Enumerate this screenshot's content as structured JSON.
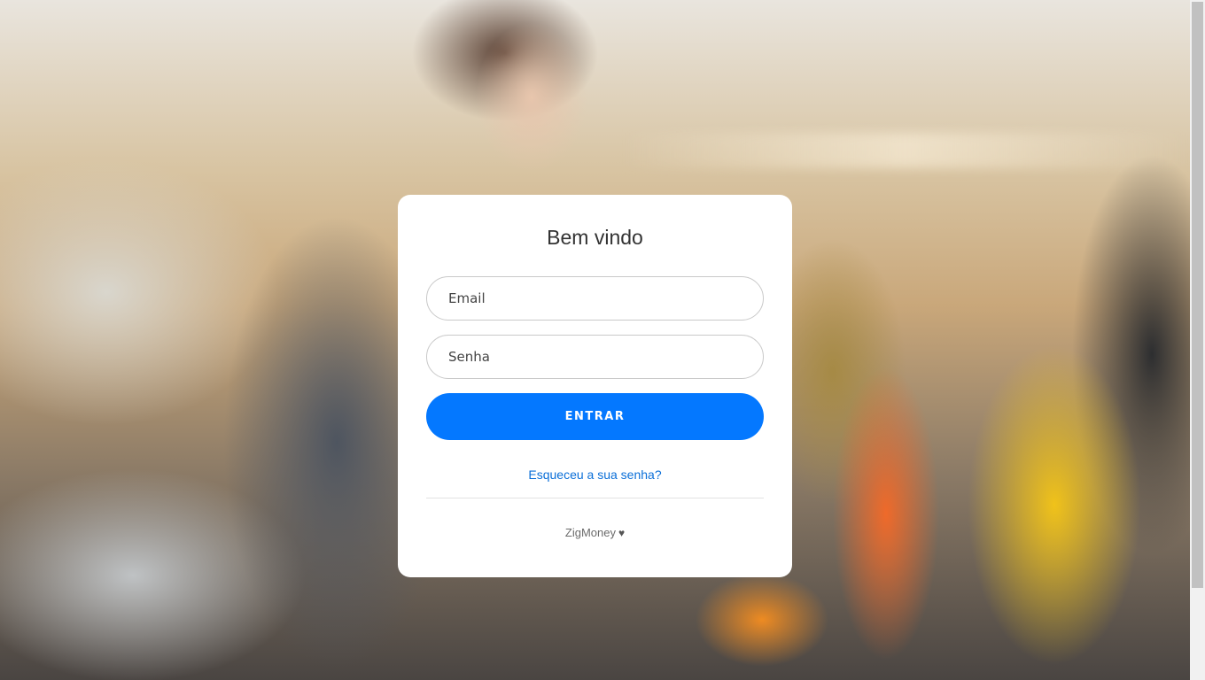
{
  "login": {
    "title": "Bem vindo",
    "email_placeholder": "Email",
    "password_placeholder": "Senha",
    "submit_label": "ENTRAR",
    "forgot_password": "Esqueceu a sua senha?"
  },
  "footer": {
    "brand": "ZigMoney",
    "icon": "heart-icon"
  },
  "colors": {
    "primary_button": "#0478ff",
    "link": "#0b6fd8"
  }
}
